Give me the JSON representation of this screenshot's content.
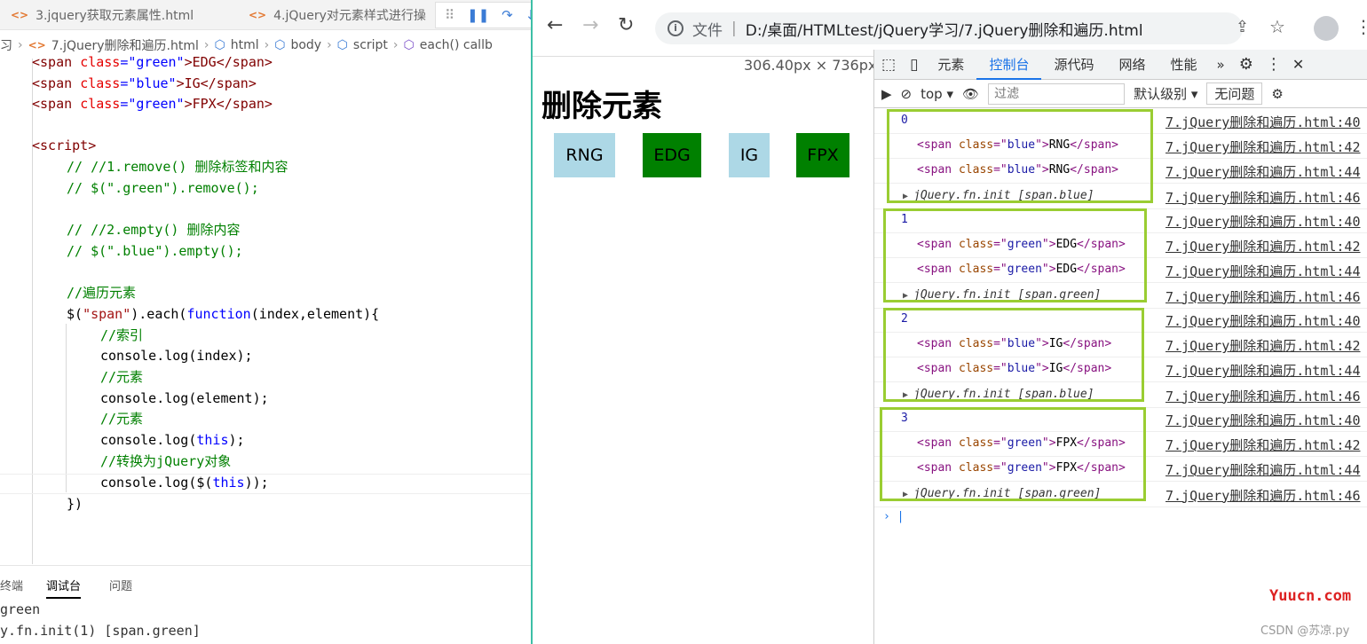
{
  "editor": {
    "tabs": [
      "3.jquery获取元素属性.html",
      "4.jQuery对元素样式进行操"
    ],
    "tab_icon": "<>",
    "breadcrumb": [
      "习",
      "7.jQuery删除和遍历.html",
      "html",
      "body",
      "script",
      "each() callb"
    ],
    "code": {
      "l1a": "<span ",
      "l1b": "class",
      "l1c": "=\"green\"",
      "l1d": ">EDG</span>",
      "l2a": "<span ",
      "l2b": "class",
      "l2c": "=\"blue\"",
      "l2d": ">IG</span>",
      "l3a": "<span ",
      "l3b": "class",
      "l3c": "=\"green\"",
      "l3d": ">FPX</span>",
      "l5": "<script>",
      "l6": "// //1.remove() 删除标签和内容",
      "l7": "// $(\".green\").remove();",
      "l9": "// //2.empty() 删除内容",
      "l10": "// $(\".blue\").empty();",
      "l12": "//遍历元素",
      "l13a": "$(",
      "l13b": "\"span\"",
      "l13c": ").each(",
      "l13d": "function",
      "l13e": "(index,element){",
      "l14": "//索引",
      "l15": "console.log(index);",
      "l16": "//元素",
      "l17": "console.log(element);",
      "l18": "//元素",
      "l19a": "console.log(",
      "l19b": "this",
      "l19c": ");",
      "l20": "//转换为jQuery对象",
      "l21a": "console.log($(",
      "l21b": "this",
      "l21c": "));",
      "l22": "})"
    },
    "panel_tabs": [
      "终端",
      "调试台",
      "问题"
    ],
    "panel_lines": [
      "green",
      "y.fn.init(1) [span.green]"
    ]
  },
  "browser": {
    "url_prefix": "文件",
    "url": "D:/桌面/HTMLtest/jQuery学习/7.jQuery删除和遍历.html",
    "dimensions": "306.40px × 736px",
    "heading": "删除元素",
    "spans": [
      "RNG",
      "EDG",
      "IG",
      "FPX"
    ],
    "devtools_tabs": [
      "元素",
      "控制台",
      "源代码",
      "网络",
      "性能"
    ],
    "context": "top",
    "filter_placeholder": "过滤",
    "levels": "默认级别",
    "issues": "无问题"
  },
  "console": {
    "groups": [
      {
        "index": "0",
        "cls": "blue",
        "text": "RNG",
        "init": "jQuery.fn.init [span.blue]"
      },
      {
        "index": "1",
        "cls": "green",
        "text": "EDG",
        "init": "jQuery.fn.init [span.green]"
      },
      {
        "index": "2",
        "cls": "blue",
        "text": "IG",
        "init": "jQuery.fn.init [span.blue]"
      },
      {
        "index": "3",
        "cls": "green",
        "text": "FPX",
        "init": "jQuery.fn.init [span.green]"
      }
    ],
    "sources": [
      "7.jQuery删除和遍历.html:40",
      "7.jQuery删除和遍历.html:42",
      "7.jQuery删除和遍历.html:44",
      "7.jQuery删除和遍历.html:46"
    ]
  },
  "watermarks": {
    "site": "Yuucn.com",
    "author": "CSDN @苏凉.py"
  },
  "colors": {
    "highlight_box": "#9acd32",
    "blue_span": "#add8e6",
    "green_span": "#008000"
  }
}
